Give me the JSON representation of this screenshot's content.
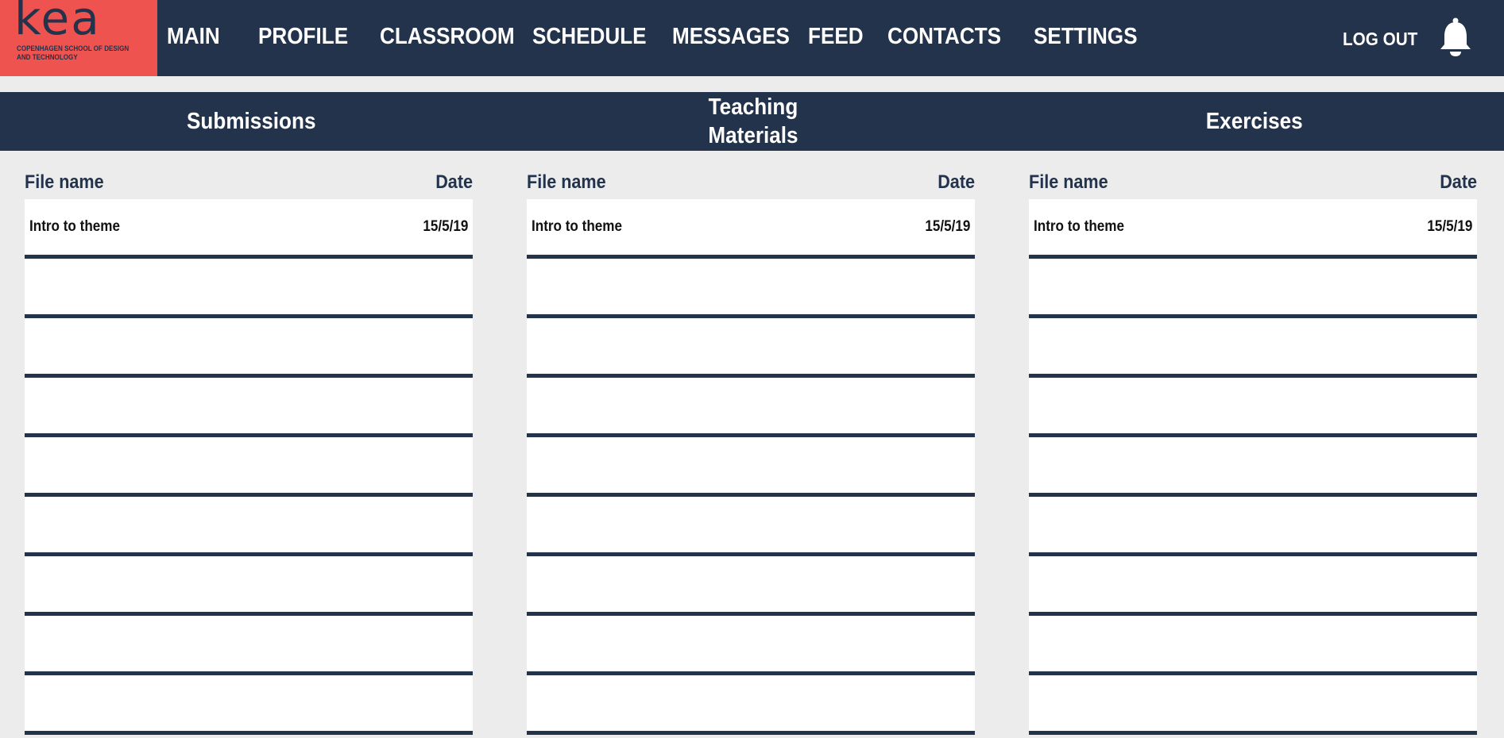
{
  "brand": {
    "logo_text": "KEA",
    "logo_subtitle": "COPENHAGEN SCHOOL OF DESIGN AND TECHNOLOGY",
    "logo_color": "#ef5350"
  },
  "colors": {
    "navy": "#23334b",
    "background": "#ececec"
  },
  "nav": {
    "items": [
      {
        "label": "MAIN"
      },
      {
        "label": "PROFILE"
      },
      {
        "label": "CLASSROOM"
      },
      {
        "label": "SCHEDULE"
      },
      {
        "label": "MESSAGES"
      },
      {
        "label": "FEED"
      },
      {
        "label": "CONTACTS"
      },
      {
        "label": "SETTINGS"
      }
    ],
    "logout_label": "LOG OUT",
    "notifications_icon": "bell-icon"
  },
  "sections": [
    {
      "title": "Submissions",
      "col_name": "File name",
      "col_date": "Date",
      "files": [
        {
          "name": "Intro to theme",
          "date": "15/5/19"
        },
        {
          "name": "",
          "date": ""
        },
        {
          "name": "",
          "date": ""
        },
        {
          "name": "",
          "date": ""
        },
        {
          "name": "",
          "date": ""
        },
        {
          "name": "",
          "date": ""
        },
        {
          "name": "",
          "date": ""
        },
        {
          "name": "",
          "date": ""
        },
        {
          "name": "",
          "date": ""
        }
      ]
    },
    {
      "title": "Teaching Materials",
      "col_name": "File name",
      "col_date": "Date",
      "files": [
        {
          "name": "Intro to theme",
          "date": "15/5/19"
        },
        {
          "name": "",
          "date": ""
        },
        {
          "name": "",
          "date": ""
        },
        {
          "name": "",
          "date": ""
        },
        {
          "name": "",
          "date": ""
        },
        {
          "name": "",
          "date": ""
        },
        {
          "name": "",
          "date": ""
        },
        {
          "name": "",
          "date": ""
        },
        {
          "name": "",
          "date": ""
        }
      ]
    },
    {
      "title": "Exercises",
      "col_name": "File name",
      "col_date": "Date",
      "files": [
        {
          "name": "Intro to theme",
          "date": "15/5/19"
        },
        {
          "name": "",
          "date": ""
        },
        {
          "name": "",
          "date": ""
        },
        {
          "name": "",
          "date": ""
        },
        {
          "name": "",
          "date": ""
        },
        {
          "name": "",
          "date": ""
        },
        {
          "name": "",
          "date": ""
        },
        {
          "name": "",
          "date": ""
        },
        {
          "name": "",
          "date": ""
        }
      ]
    }
  ]
}
